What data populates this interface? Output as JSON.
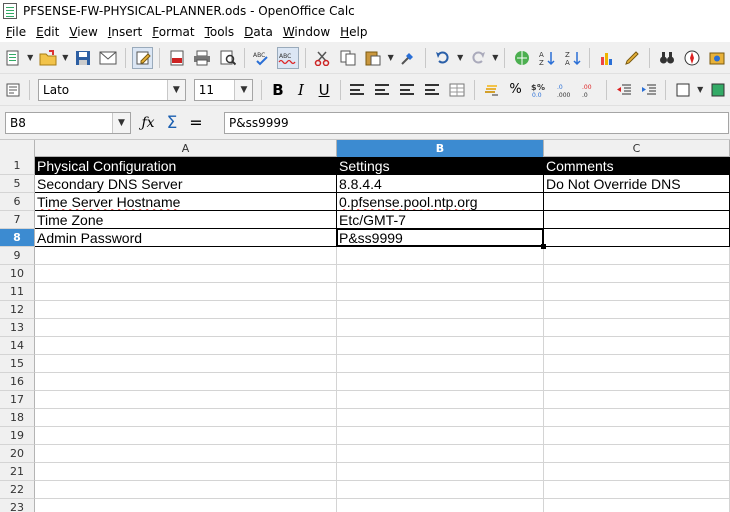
{
  "window": {
    "title": "PFSENSE-FW-PHYSICAL-PLANNER.ods - OpenOffice Calc"
  },
  "menu": [
    {
      "label": "File",
      "key": "F",
      "rest": "ile"
    },
    {
      "label": "Edit",
      "key": "E",
      "rest": "dit"
    },
    {
      "label": "View",
      "key": "V",
      "rest": "iew"
    },
    {
      "label": "Insert",
      "key": "I",
      "rest": "nsert"
    },
    {
      "label": "Format",
      "key": "F",
      "rest": "ormat"
    },
    {
      "label": "Tools",
      "key": "T",
      "rest": "ools"
    },
    {
      "label": "Data",
      "key": "D",
      "rest": "ata"
    },
    {
      "label": "Window",
      "key": "W",
      "rest": "indow"
    },
    {
      "label": "Help",
      "key": "H",
      "rest": "elp"
    }
  ],
  "formatting": {
    "font_name": "Lato",
    "font_size": "11",
    "bold": "B",
    "italic": "I",
    "underline": "U",
    "percent": "%"
  },
  "formula_bar": {
    "name_box": "B8",
    "content": "P&ss9999"
  },
  "columns": [
    "A",
    "B",
    "C"
  ],
  "selected_column": "B",
  "selected_row": "8",
  "rows": [
    {
      "num": "1",
      "a": "Physical Configuration",
      "b": "Settings",
      "c": "Comments",
      "header": true
    },
    {
      "num": "5",
      "a": "Secondary DNS Server",
      "b": "8.8.4.4",
      "c": "Do Not Override DNS"
    },
    {
      "num": "6",
      "a": "Time Server Hostname",
      "b": "0.pfsense.pool.ntp.org",
      "c": ""
    },
    {
      "num": "7",
      "a": "Time Zone",
      "b": "Etc/GMT-7",
      "c": ""
    },
    {
      "num": "8",
      "a": "Admin Password",
      "b": "P&ss9999",
      "c": ""
    },
    {
      "num": "9",
      "a": "",
      "b": "",
      "c": ""
    },
    {
      "num": "10",
      "a": "",
      "b": "",
      "c": ""
    },
    {
      "num": "11",
      "a": "",
      "b": "",
      "c": ""
    },
    {
      "num": "12",
      "a": "",
      "b": "",
      "c": ""
    },
    {
      "num": "13",
      "a": "",
      "b": "",
      "c": ""
    },
    {
      "num": "14",
      "a": "",
      "b": "",
      "c": ""
    },
    {
      "num": "15",
      "a": "",
      "b": "",
      "c": ""
    },
    {
      "num": "16",
      "a": "",
      "b": "",
      "c": ""
    },
    {
      "num": "17",
      "a": "",
      "b": "",
      "c": ""
    },
    {
      "num": "18",
      "a": "",
      "b": "",
      "c": ""
    },
    {
      "num": "19",
      "a": "",
      "b": "",
      "c": ""
    },
    {
      "num": "20",
      "a": "",
      "b": "",
      "c": ""
    },
    {
      "num": "21",
      "a": "",
      "b": "",
      "c": ""
    },
    {
      "num": "22",
      "a": "",
      "b": "",
      "c": ""
    },
    {
      "num": "23",
      "a": "",
      "b": "",
      "c": ""
    }
  ],
  "colors": {
    "selection_blue": "#3c8bd1",
    "header_fill": "#000000"
  }
}
